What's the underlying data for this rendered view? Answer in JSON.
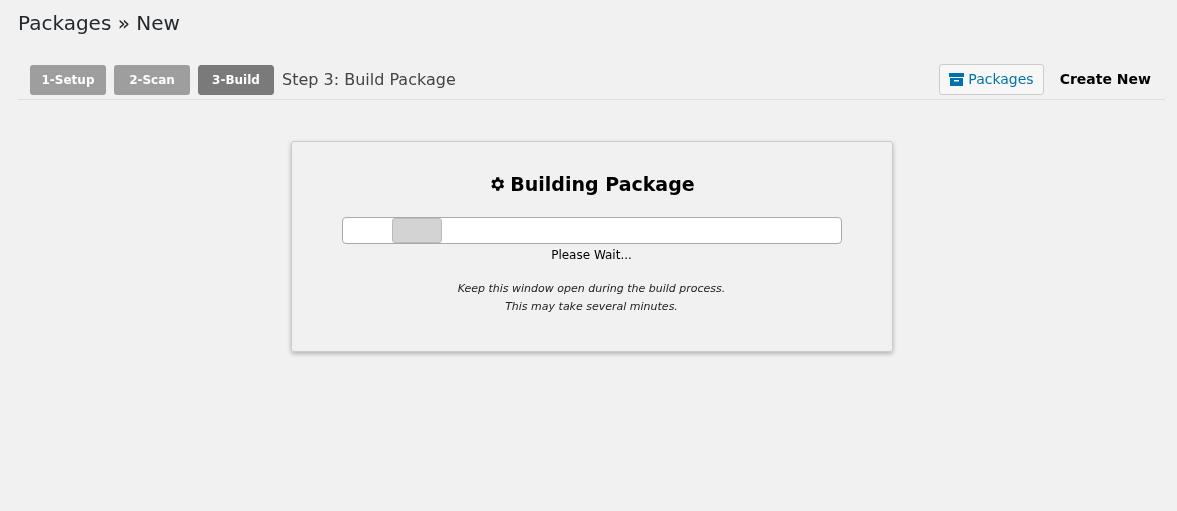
{
  "page_title": "Packages » New",
  "steps": [
    {
      "label": "1-Setup",
      "selected": false
    },
    {
      "label": "2-Scan",
      "selected": false
    },
    {
      "label": "3-Build",
      "selected": true
    }
  ],
  "step_title": "Step 3: Build Package",
  "toolbar": {
    "packages_button": "Packages",
    "create_new": "Create New"
  },
  "panel": {
    "title": "Building Package",
    "level": 0.2,
    "status": "Please Wait...",
    "notes": [
      "Keep this window open during the build process.",
      "This may take several minutes."
    ]
  }
}
